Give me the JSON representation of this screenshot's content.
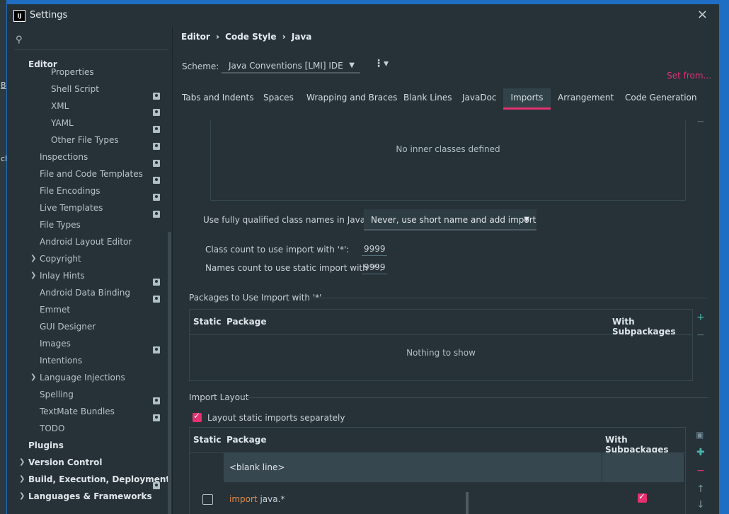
{
  "window": {
    "title": "Settings",
    "close": "×"
  },
  "left_edge": {
    "a": "B",
    "b": "cl"
  },
  "search": {
    "placeholder": ""
  },
  "sidebar": {
    "items": [
      {
        "label": "Editor"
      },
      {
        "label": "Properties"
      },
      {
        "label": "Shell Script"
      },
      {
        "label": "XML"
      },
      {
        "label": "YAML"
      },
      {
        "label": "Other File Types"
      },
      {
        "label": "Inspections"
      },
      {
        "label": "File and Code Templates"
      },
      {
        "label": "File Encodings"
      },
      {
        "label": "Live Templates"
      },
      {
        "label": "File Types"
      },
      {
        "label": "Android Layout Editor"
      },
      {
        "label": "Copyright"
      },
      {
        "label": "Inlay Hints"
      },
      {
        "label": "Android Data Binding"
      },
      {
        "label": "Emmet"
      },
      {
        "label": "GUI Designer"
      },
      {
        "label": "Images"
      },
      {
        "label": "Intentions"
      },
      {
        "label": "Language Injections"
      },
      {
        "label": "Spelling"
      },
      {
        "label": "TextMate Bundles"
      },
      {
        "label": "TODO"
      },
      {
        "label": "Plugins"
      },
      {
        "label": "Version Control"
      },
      {
        "label": "Build, Execution, Deployment"
      },
      {
        "label": "Languages & Frameworks"
      }
    ]
  },
  "breadcrumb": {
    "a": "Editor",
    "b": "Code Style",
    "c": "Java",
    "sep": "›"
  },
  "scheme": {
    "label": "Scheme:",
    "value": "Java Conventions [LMI]  IDE",
    "set_from": "Set from..."
  },
  "tabs": [
    {
      "label": "Tabs and Indents"
    },
    {
      "label": "Spaces"
    },
    {
      "label": "Wrapping and Braces"
    },
    {
      "label": "Blank Lines"
    },
    {
      "label": "JavaDoc"
    },
    {
      "label": "Imports"
    },
    {
      "label": "Arrangement"
    },
    {
      "label": "Code Generation"
    }
  ],
  "imports": {
    "inner_classes_empty": "No inner classes defined",
    "fq_label": "Use fully qualified class names in JavaDoc:",
    "fq_value": "Never, use short name and add import",
    "class_count_label": "Class count to use import with '*':",
    "class_count": "9999",
    "names_count_label": "Names count to use static import with '*':",
    "names_count": "9999",
    "packages_title": "Packages to Use Import with '*'",
    "col_static": "Static",
    "col_package": "Package",
    "col_sub": "With Subpackages",
    "nothing": "Nothing to show",
    "layout_title": "Import Layout",
    "layout_static_label": "Layout static imports separately",
    "blank_line": "<blank line>",
    "import_kw": "import",
    "import_pkg": "java.*"
  },
  "colors": {
    "accent": "#e53170",
    "bg": "#263238",
    "plus": "#4db6ac"
  }
}
